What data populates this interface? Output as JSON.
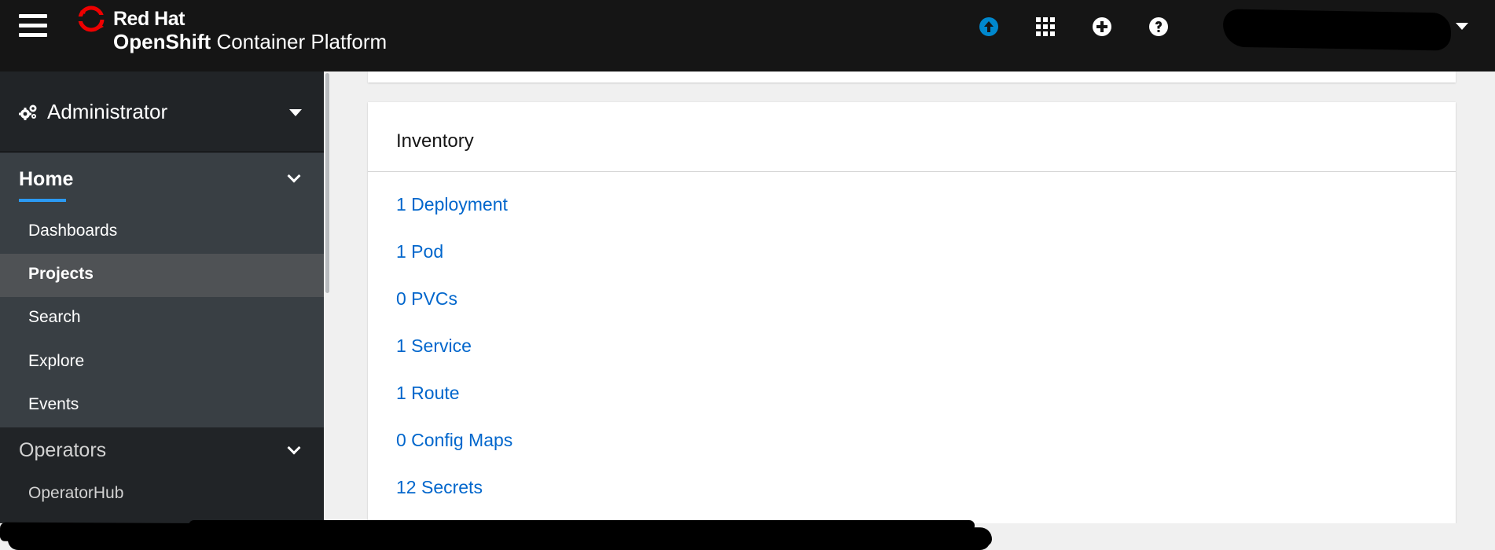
{
  "masthead": {
    "brand_line1": "Red Hat",
    "brand_product_bold": "OpenShift",
    "brand_product_rest": " Container Platform",
    "icons": [
      "menu-icon",
      "upload-icon",
      "app-launcher-icon",
      "plus-circle-icon",
      "help-icon",
      "caret-down-icon"
    ],
    "upload_icon_color": "#0088ce"
  },
  "sidebar": {
    "perspective_label": "Administrator",
    "home": {
      "title": "Home",
      "items": [
        {
          "label": "Dashboards",
          "active": false
        },
        {
          "label": "Projects",
          "active": true
        },
        {
          "label": "Search",
          "active": false
        },
        {
          "label": "Explore",
          "active": false
        },
        {
          "label": "Events",
          "active": false
        }
      ]
    },
    "operators": {
      "title": "Operators",
      "items": [
        {
          "label": "OperatorHub"
        }
      ]
    }
  },
  "inventory": {
    "title": "Inventory",
    "items": [
      {
        "label": "1 Deployment"
      },
      {
        "label": "1 Pod"
      },
      {
        "label": "0 PVCs"
      },
      {
        "label": "1 Service"
      },
      {
        "label": "1 Route"
      },
      {
        "label": "0 Config Maps"
      },
      {
        "label": "12 Secrets"
      }
    ]
  },
  "colors": {
    "masthead_bg": "#151515",
    "sidebar_bg": "#212427",
    "sidebar_section_bg": "#393f44",
    "active_item_bg": "#4f5255",
    "link": "#0066cc",
    "accent": "#2b9af3"
  }
}
